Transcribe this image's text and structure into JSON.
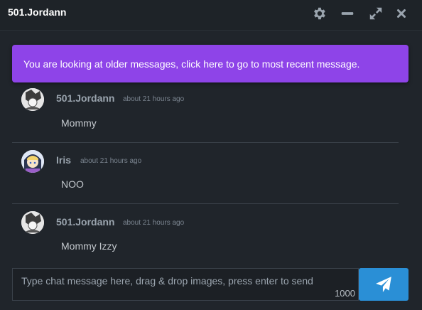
{
  "window": {
    "title": "501.Jordann",
    "controls": [
      "gear-icon",
      "minimize-icon",
      "expand-icon",
      "close-icon"
    ]
  },
  "notice": {
    "before_link": "You are looking at older messages, click ",
    "link": "here",
    "after_link": " to go to most recent message."
  },
  "messages": [
    {
      "author": "501.Jordann",
      "time": "about 21 hours ago",
      "text": "Mommy",
      "avatar": "avatar-jordann"
    },
    {
      "author": "Iris",
      "time": "about 21 hours ago",
      "text": "NOO",
      "avatar": "avatar-iris"
    },
    {
      "author": "501.Jordann",
      "time": "about 21 hours ago",
      "text": "Mommy Izzy",
      "avatar": "avatar-jordann"
    }
  ],
  "composer": {
    "placeholder": "Type chat message here, drag & drop images, press enter to send",
    "char_limit": "1000",
    "send_icon": "paper-plane-icon"
  },
  "colors": {
    "background": "#20252b",
    "notice": "#8e44e8",
    "send_button": "#2a8fd6"
  }
}
